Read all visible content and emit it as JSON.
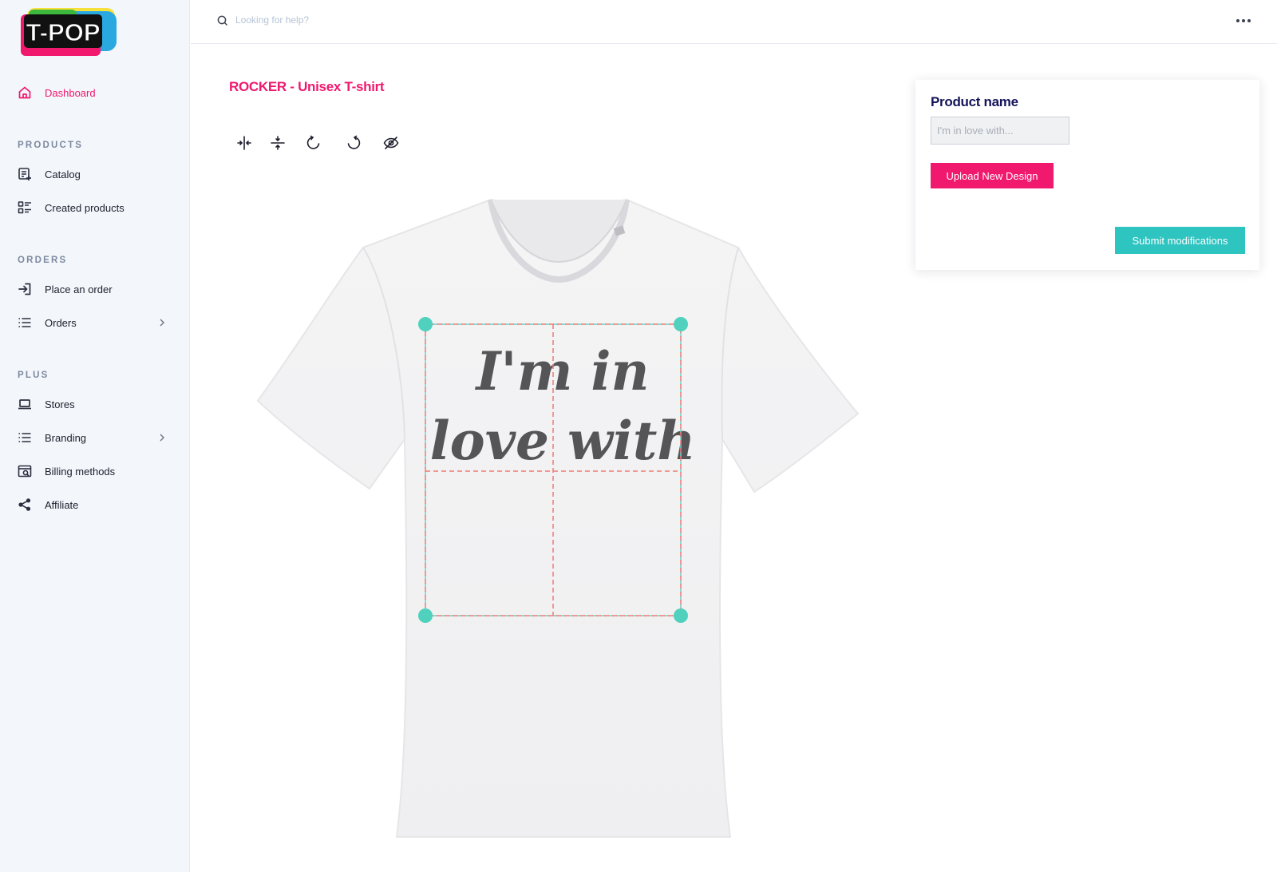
{
  "app": {
    "logo_text": "T-POP"
  },
  "colors": {
    "accent": "#f0196e",
    "teal": "#2ec4c0",
    "navy": "#14145a"
  },
  "sidebar": {
    "dashboard": {
      "label": "Dashboard",
      "icon": "home-icon",
      "active": true
    },
    "sections": {
      "products": "PRODUCTS",
      "orders": "ORDERS",
      "plus": "PLUS"
    },
    "products_items": [
      {
        "label": "Catalog",
        "icon": "catalog-icon"
      },
      {
        "label": "Created products",
        "icon": "list-detail-icon"
      }
    ],
    "orders_items": [
      {
        "label": "Place an order",
        "icon": "login-arrow-icon"
      },
      {
        "label": "Orders",
        "icon": "list-icon",
        "chevron": true
      }
    ],
    "plus_items": [
      {
        "label": "Stores",
        "icon": "laptop-icon"
      },
      {
        "label": "Branding",
        "icon": "list-icon",
        "chevron": true
      },
      {
        "label": "Billing methods",
        "icon": "billing-icon"
      },
      {
        "label": "Affiliate",
        "icon": "share-icon"
      }
    ]
  },
  "header": {
    "search_placeholder": "Looking for help?"
  },
  "main": {
    "title": "ROCKER - Unisex T-shirt",
    "toolbar": [
      {
        "name": "center-horizontal-icon"
      },
      {
        "name": "center-vertical-icon"
      },
      {
        "name": "rotate-left-icon"
      },
      {
        "name": "rotate-right-icon"
      },
      {
        "name": "hide-icon"
      }
    ],
    "design_text_line1": "I'm in",
    "design_text_line2": "love with"
  },
  "panel": {
    "title": "Product name",
    "input_placeholder": "I'm in love with...",
    "input_value": "",
    "upload_label": "Upload New Design",
    "submit_label": "Submit modifications"
  }
}
